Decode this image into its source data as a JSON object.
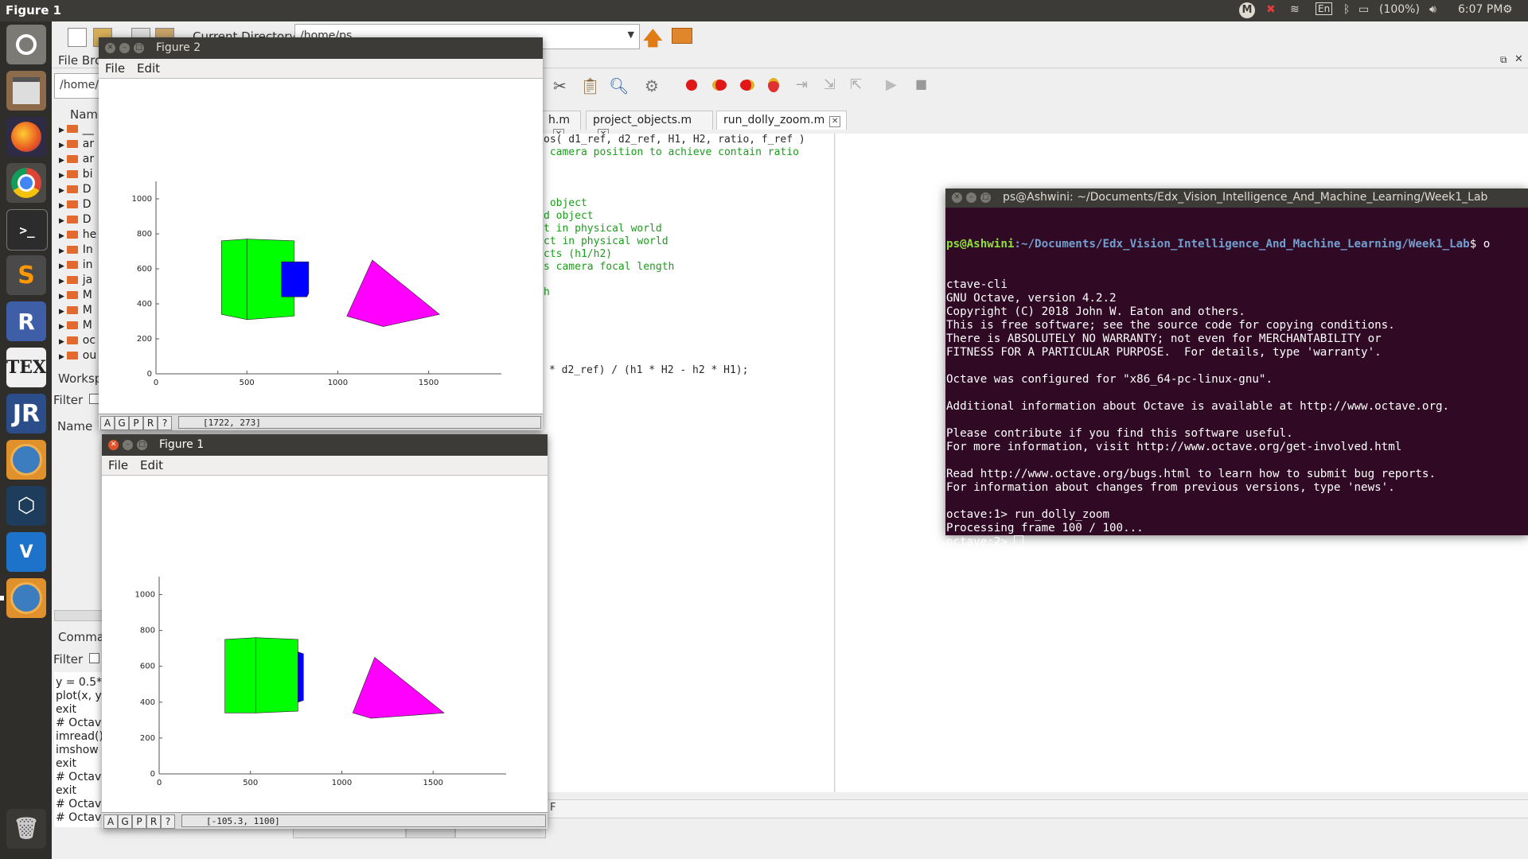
{
  "top_panel": {
    "app_title": "Figure 1",
    "lang": "En",
    "battery": "(100%)",
    "time": "6:07 PM"
  },
  "launcher": {
    "items": [
      "Ubuntu",
      "Files",
      "Firefox",
      "Chrome",
      "Terminal",
      "Sublime Text",
      "R",
      "TeX",
      "JabRef",
      "Octave",
      "VirtualBox",
      "VNC",
      "Octave",
      "Trash"
    ]
  },
  "octave": {
    "current_directory_label": "Current Directory:",
    "current_directory_value": "/home/ps",
    "file_browser_label": "File Bro",
    "path_field": "/home/",
    "name_header": "Name",
    "tree_items": [
      "__",
      "ar",
      "ar",
      "bi",
      "D",
      "D",
      "D",
      "he",
      "In",
      "in",
      "ja",
      "M",
      "M",
      "M",
      "oc",
      "ou"
    ],
    "workspace_label": "Worksp",
    "filter_label": "Filter",
    "workspace_name_header": "Name",
    "command_label": "Comman",
    "command_filter_label": "Filter",
    "history": [
      "y = 0.5*s",
      "plot(x, y)",
      "exit",
      "# Octave",
      "imread()",
      "imshow",
      "exit",
      "# Octave",
      "exit",
      "# Octave",
      "# Octave"
    ],
    "tabs": [
      {
        "label": "h.m"
      },
      {
        "label": "project_objects.m"
      },
      {
        "label": "run_dolly_zoom.m"
      }
    ],
    "code_lines": [
      {
        "text": "os( d1_ref, d2_ref, H1, H2, ratio, f_ref )",
        "color": "#2a2a2a"
      },
      {
        "text": " camera position to achieve contain ratio",
        "color": "#1a9e1a"
      },
      {
        "text": "",
        "color": "#2a2a2a"
      },
      {
        "text": "",
        "color": "#2a2a2a"
      },
      {
        "text": "",
        "color": "#2a2a2a"
      },
      {
        "text": " object",
        "color": "#1a9e1a"
      },
      {
        "text": "d object",
        "color": "#1a9e1a"
      },
      {
        "text": "t in physical world",
        "color": "#1a9e1a"
      },
      {
        "text": "ct in physical world",
        "color": "#1a9e1a"
      },
      {
        "text": "cts (h1/h2)",
        "color": "#1a9e1a"
      },
      {
        "text": "s camera focal length",
        "color": "#1a9e1a"
      },
      {
        "text": "",
        "color": "#2a2a2a"
      },
      {
        "text": "h",
        "color": "#1a9e1a"
      }
    ],
    "code_formula": "* d2_ref) / (h1 * H2 - h2 * H1);",
    "bottom_tabs": [
      "Command Window",
      "Editor",
      "Documentation"
    ],
    "status_fragment": "F"
  },
  "figure2": {
    "title": "Figure 2",
    "menu": [
      "File",
      "Edit"
    ],
    "status_buttons": [
      "A",
      "G",
      "P",
      "R",
      "?"
    ],
    "coords": "[1722, 273]"
  },
  "figure1": {
    "title": "Figure 1",
    "menu": [
      "File",
      "Edit"
    ],
    "status_buttons": [
      "A",
      "G",
      "P",
      "R",
      "?"
    ],
    "coords": "[-105.3, 1100]"
  },
  "chart_data": [
    {
      "type": "scatter",
      "title": "",
      "xlabel": "",
      "ylabel": "",
      "xlim": [
        0,
        1900
      ],
      "ylim": [
        0,
        1100
      ],
      "x_ticks": [
        0,
        500,
        1000,
        1500
      ],
      "y_ticks": [
        0,
        200,
        400,
        600,
        800,
        1000
      ],
      "objects": [
        {
          "name": "cube-front",
          "color": "#00ff00",
          "polygon": [
            [
              360,
              340
            ],
            [
              500,
              310
            ],
            [
              500,
              770
            ],
            [
              360,
              760
            ]
          ]
        },
        {
          "name": "cube-side",
          "color": "#00ff00",
          "polygon": [
            [
              500,
              310
            ],
            [
              760,
              330
            ],
            [
              760,
              760
            ],
            [
              500,
              770
            ]
          ]
        },
        {
          "name": "blue-box",
          "color": "#0000ff",
          "polygon": [
            [
              690,
              440
            ],
            [
              830,
              440
            ],
            [
              840,
              460
            ],
            [
              840,
              640
            ],
            [
              830,
              640
            ],
            [
              690,
              640
            ]
          ]
        },
        {
          "name": "pyramid",
          "color": "#ff00ff",
          "polygon": [
            [
              1190,
              650
            ],
            [
              1050,
              330
            ],
            [
              1250,
              270
            ],
            [
              1560,
              340
            ]
          ]
        }
      ]
    },
    {
      "type": "scatter",
      "title": "",
      "xlabel": "",
      "ylabel": "",
      "xlim": [
        0,
        1900
      ],
      "ylim": [
        0,
        1100
      ],
      "x_ticks": [
        0,
        500,
        1000,
        1500
      ],
      "y_ticks": [
        0,
        200,
        400,
        600,
        800,
        1000
      ],
      "objects": [
        {
          "name": "cube-front",
          "color": "#00ff00",
          "polygon": [
            [
              360,
              340
            ],
            [
              530,
              340
            ],
            [
              530,
              760
            ],
            [
              360,
              750
            ]
          ]
        },
        {
          "name": "cube-side",
          "color": "#00ff00",
          "polygon": [
            [
              530,
              340
            ],
            [
              760,
              350
            ],
            [
              760,
              750
            ],
            [
              530,
              760
            ]
          ]
        },
        {
          "name": "blue-box",
          "color": "#0000ff",
          "polygon": [
            [
              760,
              400
            ],
            [
              790,
              410
            ],
            [
              790,
              670
            ],
            [
              760,
              680
            ]
          ]
        },
        {
          "name": "pyramid",
          "color": "#ff00ff",
          "polygon": [
            [
              1180,
              650
            ],
            [
              1060,
              340
            ],
            [
              1160,
              310
            ],
            [
              1560,
              340
            ]
          ]
        }
      ]
    }
  ],
  "terminal": {
    "title": "ps@Ashwini: ~/Documents/Edx_Vision_Intelligence_And_Machine_Learning/Week1_Lab",
    "prompt_user": "ps@Ashwini",
    "prompt_path": ":~/Documents/Edx_Vision_Intelligence_And_Machine_Learning/Week1_Lab",
    "prompt_cmd": "$ o",
    "lines": [
      "ctave-cli",
      "GNU Octave, version 4.2.2",
      "Copyright (C) 2018 John W. Eaton and others.",
      "This is free software; see the source code for copying conditions.",
      "There is ABSOLUTELY NO WARRANTY; not even for MERCHANTABILITY or",
      "FITNESS FOR A PARTICULAR PURPOSE.  For details, type 'warranty'.",
      "",
      "Octave was configured for \"x86_64-pc-linux-gnu\".",
      "",
      "Additional information about Octave is available at http://www.octave.org.",
      "",
      "Please contribute if you find this software useful.",
      "For more information, visit http://www.octave.org/get-involved.html",
      "",
      "Read http://www.octave.org/bugs.html to learn how to submit bug reports.",
      "For information about changes from previous versions, type 'news'.",
      "",
      "octave:1> run_dolly_zoom",
      "Processing frame 100 / 100...",
      "octave:2> "
    ]
  }
}
